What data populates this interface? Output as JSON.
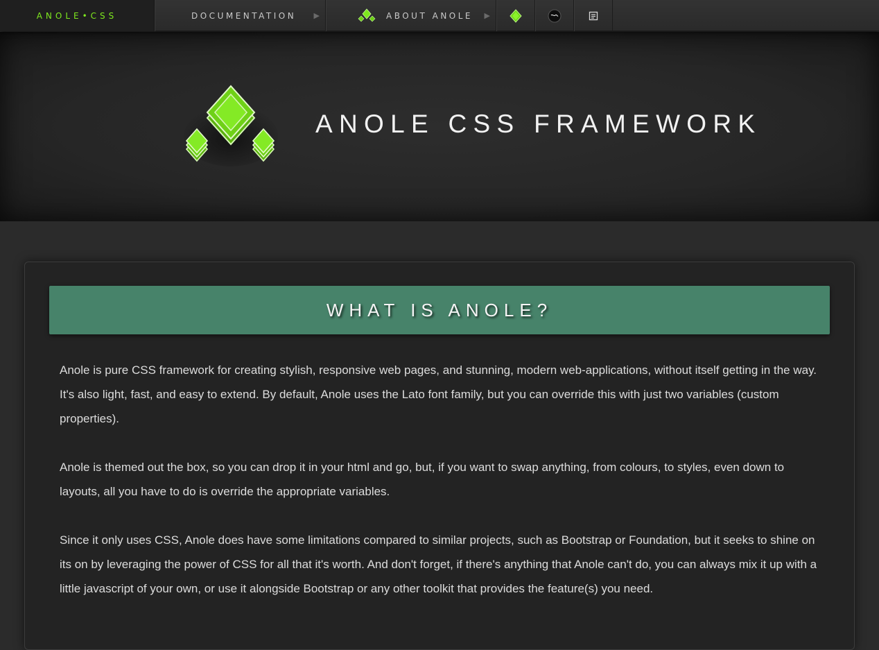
{
  "nav": {
    "brand": "ANOLE•CSS",
    "documentation_label": "DOCUMENTATION",
    "about_label": "ABOUT ANOLE",
    "arrow": "▶",
    "icons": [
      "anole-logo-icon",
      "diamond-icon",
      "github-octocat-icon",
      "document-icon"
    ]
  },
  "hero": {
    "title": "ANOLE CSS FRAMEWORK",
    "logo_icon": "anole-logo-icon"
  },
  "panel": {
    "heading": "WHAT IS ANOLE?",
    "paragraphs": [
      "Anole is pure CSS framework for creating stylish, responsive web pages, and stunning, modern web-applications, without itself getting in the way. It's also light, fast, and easy to extend. By default, Anole uses the Lato font family, but you can override this with just two variables (custom properties).",
      "Anole is themed out the box, so you can drop it in your html and go, but, if you want to swap anything, from colours, to styles, even down to layouts, all you have to do is override the appropriate variables.",
      "Since it only uses CSS, Anole does have some limitations compared to similar projects, such as Bootstrap or Foundation, but it seeks to shine on its on by leveraging the power of CSS for all that it's worth. And don't forget, if there's anything that Anole can't do, you can always mix it up with a little javascript of your own, or use it alongside Bootstrap or any other toolkit that provides the feature(s) you need."
    ]
  },
  "colors": {
    "accent_green": "#7ee81e",
    "header_green": "#47836a",
    "background": "#2b2b2b"
  }
}
